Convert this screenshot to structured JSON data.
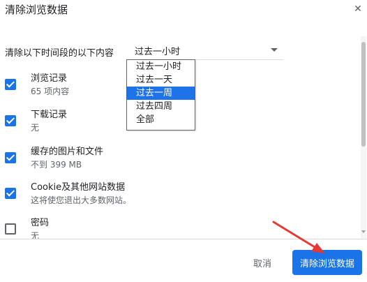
{
  "dialog": {
    "title": "清除浏览数据",
    "close_icon": "close-icon"
  },
  "time_range": {
    "label": "清除以下时间段的以下内容",
    "selected_value": "过去一小时",
    "options": [
      "过去一小时",
      "过去一天",
      "过去一周",
      "过去四周",
      "全部"
    ],
    "highlighted_option": "过去一周"
  },
  "items": [
    {
      "title": "浏览记录",
      "subtitle": "65 项内容",
      "checked": true
    },
    {
      "title": "下载记录",
      "subtitle": "无",
      "checked": true
    },
    {
      "title": "缓存的图片和文件",
      "subtitle": "不到 399 MB",
      "checked": true
    },
    {
      "title": "Cookie及其他网站数据",
      "subtitle": "这将使您退出大多数网站。",
      "checked": true
    },
    {
      "title": "密码",
      "subtitle": "无",
      "checked": false
    }
  ],
  "footer": {
    "cancel_label": "取消",
    "clear_label": "清除浏览数据"
  },
  "colors": {
    "accent": "#1a73e8",
    "highlight": "#1e73e8",
    "annotation_arrow": "#e53935"
  }
}
